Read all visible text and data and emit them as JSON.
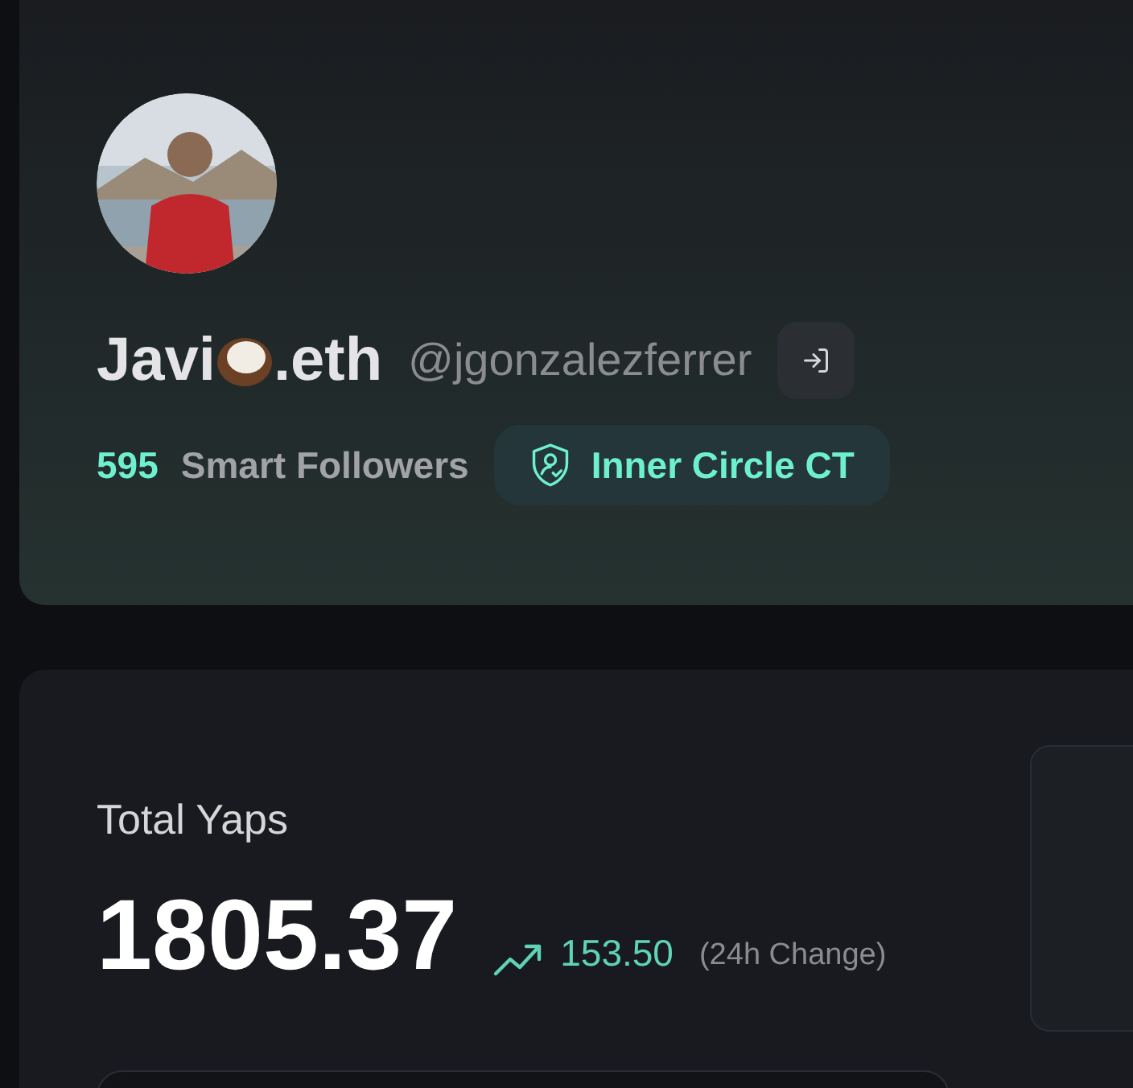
{
  "profile": {
    "name_before_emoji": "Javi",
    "name_after_emoji": ".eth",
    "handle": "@jgonzalezferrer",
    "smart_followers_count": "595",
    "smart_followers_label": "Smart Followers",
    "badge": "Inner Circle CT"
  },
  "yaps": {
    "title": "Total Yaps",
    "total": "1805.37",
    "change": "153.50",
    "change_label": "(24h Change)"
  }
}
